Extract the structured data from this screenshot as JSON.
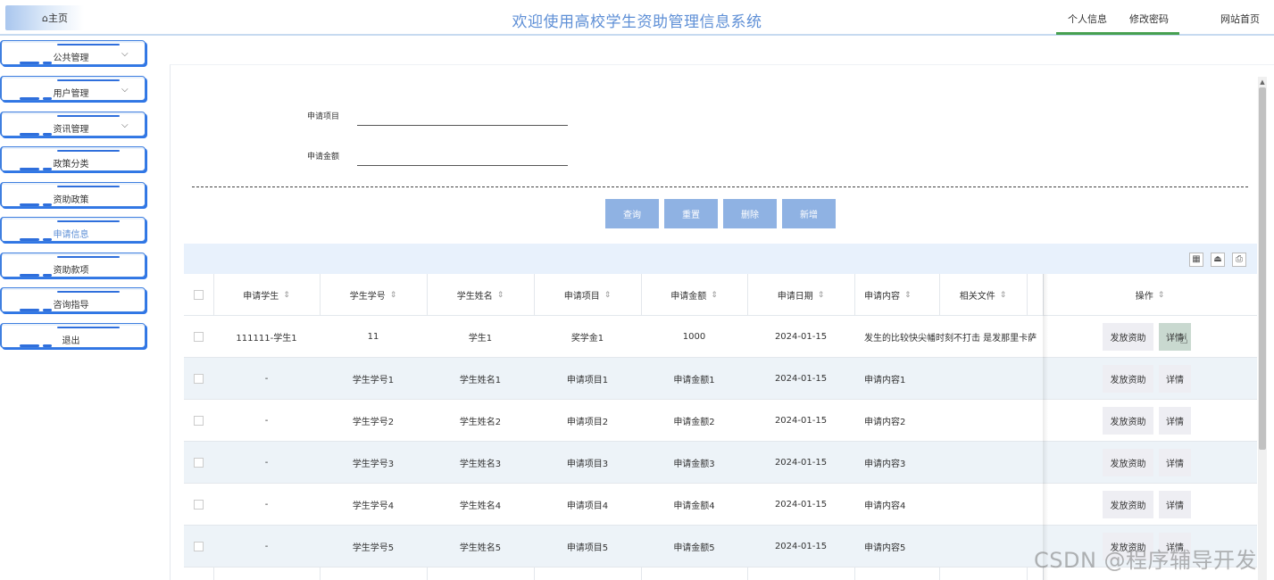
{
  "header": {
    "home": "主页",
    "title": "欢迎使用高校学生资助管理信息系统",
    "links": [
      "个人信息",
      "修改密码",
      "网站首页"
    ]
  },
  "sidebar": {
    "items": [
      {
        "label": "公共管理",
        "has_arrow": true
      },
      {
        "label": "用户管理",
        "has_arrow": true
      },
      {
        "label": "资讯管理",
        "has_arrow": true
      },
      {
        "label": "政策分类",
        "has_arrow": false
      },
      {
        "label": "资助政策",
        "has_arrow": false
      },
      {
        "label": "申请信息",
        "has_arrow": false,
        "active": true
      },
      {
        "label": "资助款项",
        "has_arrow": false
      },
      {
        "label": "咨询指导",
        "has_arrow": false
      },
      {
        "label": "退出",
        "has_arrow": false
      }
    ]
  },
  "search": {
    "fields": [
      {
        "label": "申请项目",
        "value": ""
      },
      {
        "label": "申请金额",
        "value": ""
      }
    ],
    "buttons": [
      "查询",
      "重置",
      "删除",
      "新增"
    ]
  },
  "table": {
    "columns": [
      "申请学生",
      "学生学号",
      "学生姓名",
      "申请项目",
      "申请金额",
      "申请日期",
      "申请内容",
      "相关文件",
      "操作"
    ],
    "rows": [
      [
        "111111-学生1",
        "11",
        "学生1",
        "奖学金1",
        "1000",
        "2024-01-15",
        "发生的比较快尖幡时刻不打击 是发那里卡萨"
      ],
      [
        "-",
        "学生学号1",
        "学生姓名1",
        "申请项目1",
        "申请金额1",
        "2024-01-15",
        "申请内容1"
      ],
      [
        "-",
        "学生学号2",
        "学生姓名2",
        "申请项目2",
        "申请金额2",
        "2024-01-15",
        "申请内容2"
      ],
      [
        "-",
        "学生学号3",
        "学生姓名3",
        "申请项目3",
        "申请金额3",
        "2024-01-15",
        "申请内容3"
      ],
      [
        "-",
        "学生学号4",
        "学生姓名4",
        "申请项目4",
        "申请金额4",
        "2024-01-15",
        "申请内容4"
      ],
      [
        "-",
        "学生学号5",
        "学生姓名5",
        "申请项目5",
        "申请金额5",
        "2024-01-15",
        "申请内容5"
      ]
    ],
    "actions": [
      "发放资助",
      "详情"
    ],
    "sort_glyph": "⇕"
  },
  "watermark": "CSDN @程序辅导开发",
  "colors": {
    "accent": "#5e8fd6",
    "button": "#8fb2e3",
    "toolbar": "#e8f1fc",
    "stripe": "#edf3f8",
    "sidebar_border": "#2f6fdc"
  }
}
